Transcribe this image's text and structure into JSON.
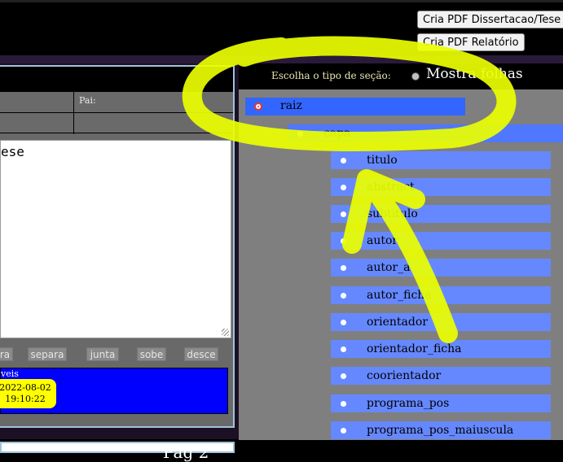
{
  "header": {
    "btn_dissertacao": "Cria PDF Dissertacao/Tese",
    "btn_relatorio": "Cria PDF Relatório"
  },
  "editor": {
    "pai_label": "Pai:",
    "text_value": "ese",
    "buttons": [
      "ra",
      "separa",
      "junta",
      "sobe",
      "desce"
    ],
    "info_title": "veis",
    "date": "2022-08-02",
    "time": "19:10:22"
  },
  "bottom": {
    "text": "Pag 2"
  },
  "tree": {
    "label": "Escolha o tipo de seção:",
    "radio_label": "Mostra folhas",
    "root": "raiz",
    "level1": "capa",
    "items": [
      "titulo",
      "abstract",
      "subtitulo",
      "autor",
      "autor_a",
      "autor_ficha",
      "orientador",
      "orientador_ficha",
      "coorientador",
      "programa_pos",
      "programa_pos_maiuscula"
    ]
  },
  "colors": {
    "root_node": "#3366ff",
    "child_node": "#6688ff",
    "annotation": "#eaff00",
    "info_box": "#0000ff",
    "date_badge": "#ffff00"
  }
}
